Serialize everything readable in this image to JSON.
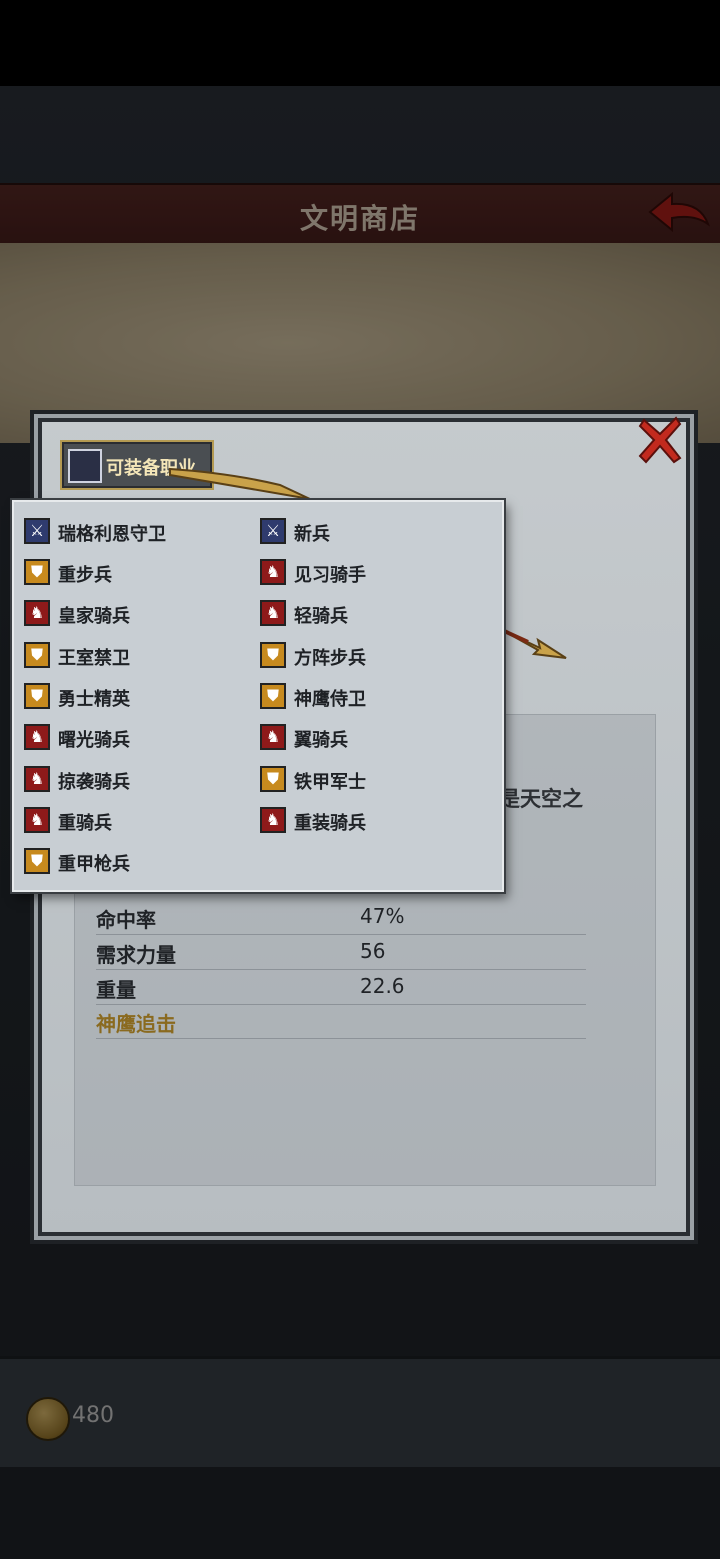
{
  "header": {
    "title": "文明商店"
  },
  "wallet": {
    "coins": "480"
  },
  "modal": {
    "equip_label": "可装备职业",
    "desc_fragment": "正是天空之",
    "stats": [
      {
        "name": "命中率",
        "value": "47%"
      },
      {
        "name": "需求力量",
        "value": "56"
      },
      {
        "name": "重量",
        "value": "22.6"
      },
      {
        "name": "神鹰追击",
        "value": ""
      }
    ]
  },
  "classes": {
    "left": [
      {
        "name": "瑞格利恩守卫",
        "icon": "sword-icon"
      },
      {
        "name": "重步兵",
        "icon": "shield-icon"
      },
      {
        "name": "皇家骑兵",
        "icon": "horse-icon"
      },
      {
        "name": "王室禁卫",
        "icon": "shield-icon"
      },
      {
        "name": "勇士精英",
        "icon": "shield-icon"
      },
      {
        "name": "曙光骑兵",
        "icon": "horse-icon"
      },
      {
        "name": "掠袭骑兵",
        "icon": "horse-icon"
      },
      {
        "name": "重骑兵",
        "icon": "horse-icon"
      },
      {
        "name": "重甲枪兵",
        "icon": "shield-icon"
      }
    ],
    "right": [
      {
        "name": "新兵",
        "icon": "sword-icon"
      },
      {
        "name": "见习骑手",
        "icon": "horse-icon"
      },
      {
        "name": "轻骑兵",
        "icon": "horse-icon"
      },
      {
        "name": "方阵步兵",
        "icon": "shield-icon"
      },
      {
        "name": "神鹰侍卫",
        "icon": "shield-icon"
      },
      {
        "name": "翼骑兵",
        "icon": "horse-icon"
      },
      {
        "name": "铁甲军士",
        "icon": "shield-icon"
      },
      {
        "name": "重装骑兵",
        "icon": "horse-icon"
      }
    ]
  },
  "colors": {
    "title_bar": "#4a201d",
    "accent_gold": "#b49a52",
    "sword": "#2f3b6e",
    "shield": "#c78a1e",
    "horse": "#8e1a1a"
  }
}
